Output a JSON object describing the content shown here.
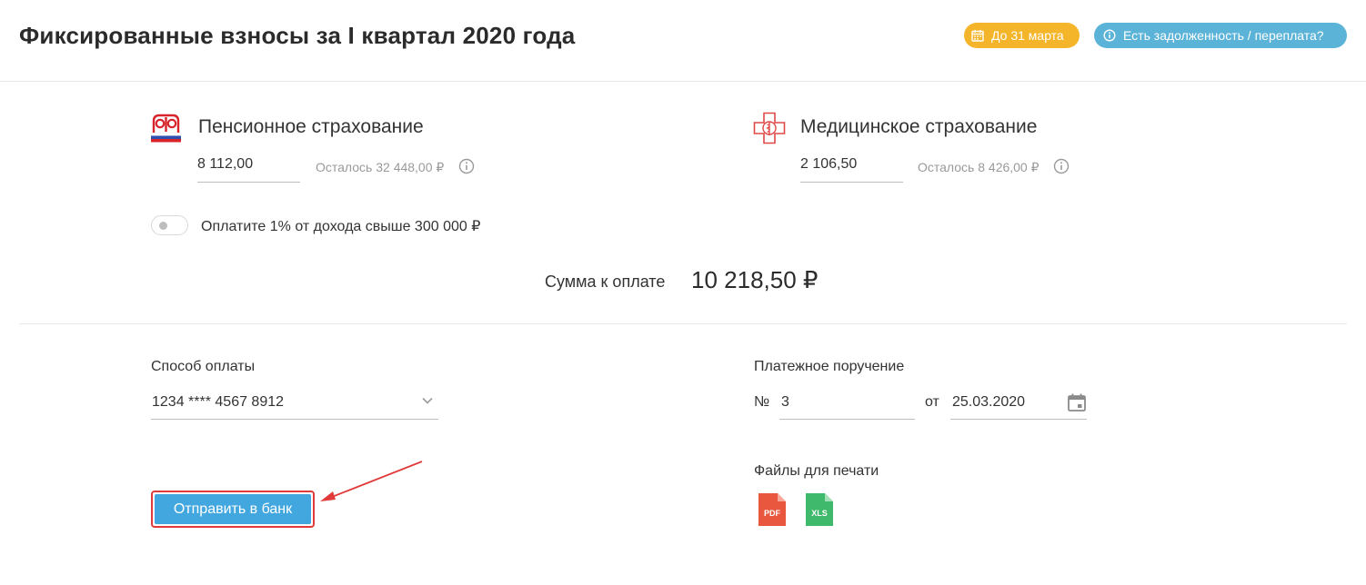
{
  "header": {
    "title": "Фиксированные взносы за I квартал 2020 года",
    "deadline_label": "До 31 марта",
    "debt_label": "Есть задолженность / переплата?"
  },
  "pension": {
    "title": "Пенсионное страхование",
    "amount": "8 112,00",
    "remaining": "Осталось 32 448,00 ₽",
    "icon": "pfr-logo-icon"
  },
  "medical": {
    "title": "Медицинское страхование",
    "amount": "2 106,50",
    "remaining": "Осталось 8 426,00 ₽",
    "icon": "medical-cross-icon"
  },
  "extra": {
    "toggle_label": "Оплатите 1% от дохода свыше 300 000 ₽",
    "toggle_on": false
  },
  "total": {
    "label": "Сумма к оплате",
    "value": "10 218,50 ₽"
  },
  "payment": {
    "method_label": "Способ оплаты",
    "method_value": "1234 **** 4567 8912",
    "send_button": "Отправить в банк"
  },
  "order": {
    "label": "Платежное поручение",
    "number_sign": "№",
    "number": "3",
    "from_label": "от",
    "date": "25.03.2020",
    "files_label": "Файлы для печати",
    "pdf_label": "PDF",
    "xls_label": "XLS"
  },
  "colors": {
    "deadline_pill": "#f5b52a",
    "debt_pill": "#5bb3d8",
    "send_button": "#42a6df",
    "highlight": "#e03a3a",
    "pdf": "#e9573f",
    "xls": "#3fb96b"
  }
}
